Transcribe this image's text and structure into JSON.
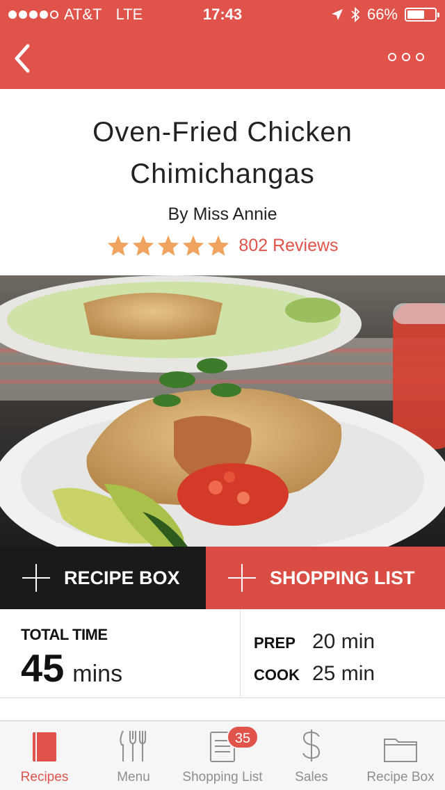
{
  "status_bar": {
    "carrier": "AT&T",
    "network": "LTE",
    "time": "17:43",
    "battery": "66%",
    "battery_level": 0.66,
    "signal_bars": 4,
    "signal_max": 5
  },
  "nav": {
    "back_icon": "chevron-left-icon",
    "more_icon": "more-dots-icon"
  },
  "recipe": {
    "title": "Oven-Fried Chicken Chimichangas",
    "author": "By Miss Annie",
    "rating": 5,
    "rating_max": 5,
    "reviews": "802 Reviews"
  },
  "actions": {
    "recipe_box": "RECIPE BOX",
    "shopping_list": "SHOPPING LIST"
  },
  "times": {
    "total_label": "TOTAL TIME",
    "total_value": "45",
    "total_unit": "mins",
    "prep_label": "PREP",
    "prep_value": "20 min",
    "cook_label": "COOK",
    "cook_value": "25 min"
  },
  "tabs": [
    {
      "label": "Recipes",
      "icon": "notebook-icon",
      "active": true
    },
    {
      "label": "Menu",
      "icon": "utensils-icon",
      "active": false
    },
    {
      "label": "Shopping List",
      "icon": "list-icon",
      "active": false,
      "badge": "35"
    },
    {
      "label": "Sales",
      "icon": "dollar-icon",
      "active": false
    },
    {
      "label": "Recipe Box",
      "icon": "folder-icon",
      "active": false
    }
  ],
  "colors": {
    "accent": "#e0534a",
    "star": "#f0a35e",
    "dark_button": "#1a1a1a"
  }
}
